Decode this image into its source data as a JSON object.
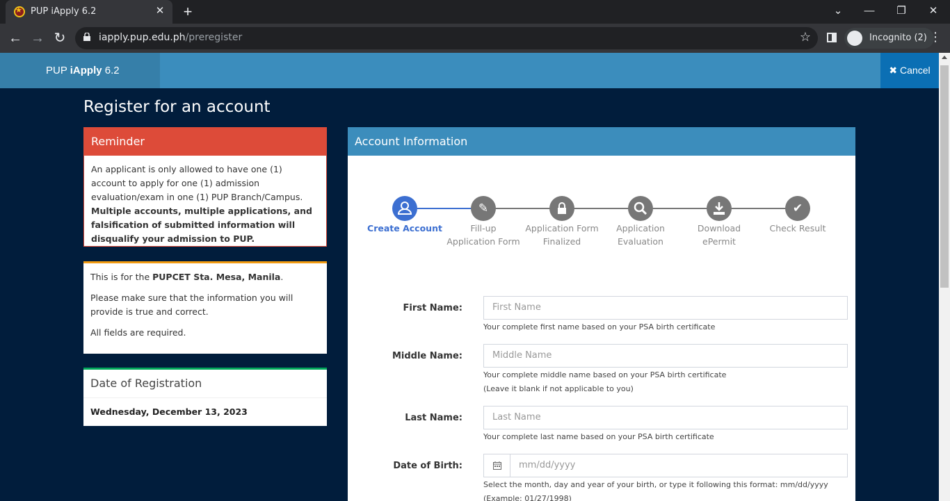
{
  "browser": {
    "tab_title": "PUP iApply 6.2",
    "tab_close": "✕",
    "new_tab": "+",
    "url_host": "iapply.pup.edu.ph",
    "url_path": "/preregister",
    "incognito_label": "Incognito (2)",
    "minimize": "—",
    "maximize": "❐",
    "close": "✕",
    "chevron": "⌄",
    "menu": "⋮"
  },
  "header": {
    "brand_prefix": "PUP ",
    "brand_bold": "iApply",
    "brand_suffix": " 6.2",
    "cancel_label": "Cancel",
    "cancel_icon": "✖"
  },
  "page": {
    "title": "Register for an account"
  },
  "reminder": {
    "title": "Reminder",
    "text_plain": "An applicant is only allowed to have one (1) account to apply for one (1) admission evaluation/exam in one (1) PUP Branch/Campus. ",
    "text_bold": "Multiple accounts, multiple applications, and falsification of submitted information will disqualify your admission to PUP."
  },
  "info": {
    "line1_prefix": "This is for the ",
    "line1_bold": "PUPCET Sta. Mesa, Manila",
    "line1_suffix": ".",
    "line2": "Please make sure that the information you will provide is true and correct.",
    "line3": "All fields are required."
  },
  "date_registration": {
    "title": "Date of Registration",
    "value": "Wednesday, December 13, 2023"
  },
  "account": {
    "title": "Account Information",
    "steps": [
      {
        "label": "Create Account",
        "icon": "user-icon",
        "active": true
      },
      {
        "label": "Fill-up Application Form",
        "icon": "edit-icon",
        "active": false
      },
      {
        "label": "Application Form Finalized",
        "icon": "lock-icon",
        "active": false
      },
      {
        "label": "Application Evaluation",
        "icon": "search-icon",
        "active": false
      },
      {
        "label": "Download ePermit",
        "icon": "download-icon",
        "active": false
      },
      {
        "label": "Check Result",
        "icon": "check-icon",
        "active": false
      }
    ],
    "fields": {
      "first_name": {
        "label": "First Name:",
        "placeholder": "First Name",
        "help": "Your complete first name based on your PSA birth certificate"
      },
      "middle_name": {
        "label": "Middle Name:",
        "placeholder": "Middle Name",
        "help": "Your complete middle name based on your PSA birth certificate",
        "help2": "(Leave it blank if not applicable to you)"
      },
      "last_name": {
        "label": "Last Name:",
        "placeholder": "Last Name",
        "help": "Your complete last name based on your PSA birth certificate"
      },
      "dob": {
        "label": "Date of Birth:",
        "placeholder": "mm/dd/yyyy",
        "help": "Select the month, day and year of your birth, or type it following this format: mm/dd/yyyy (Example: 01/27/1998)"
      }
    }
  }
}
